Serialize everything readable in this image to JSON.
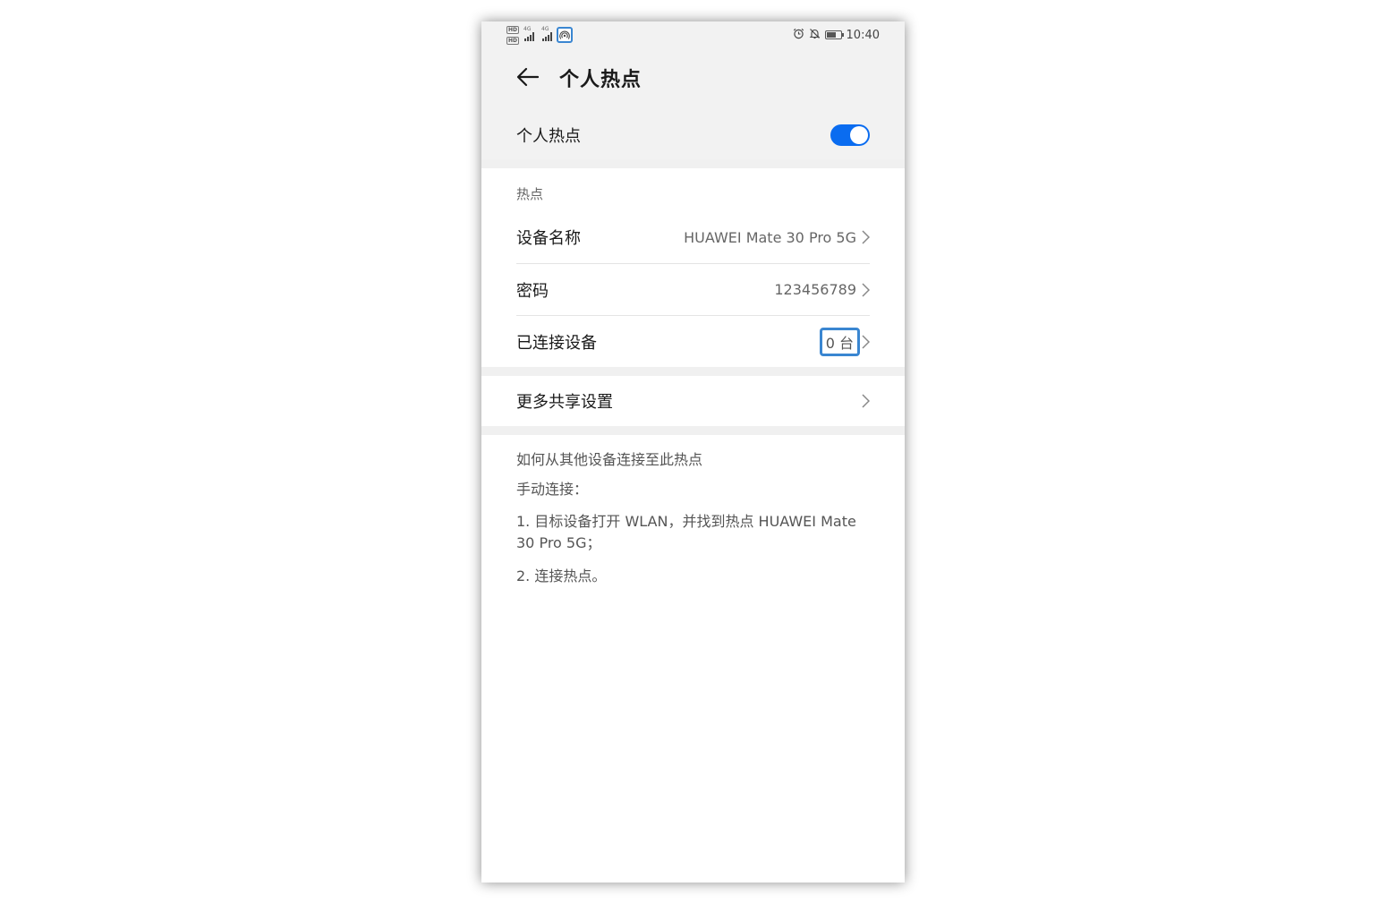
{
  "status_bar": {
    "hd_badge": "HD",
    "signal_type_1": "4G",
    "signal_type_2": "4G",
    "icons": [
      "hotspot-icon",
      "alarm-icon",
      "mute-icon",
      "battery-icon"
    ],
    "time": "10:40",
    "battery_level": 0.7
  },
  "header": {
    "back_icon": "arrow-left-icon",
    "title": "个人热点"
  },
  "hotspot_toggle": {
    "label": "个人热点",
    "enabled": true
  },
  "hotspot_section": {
    "title": "热点",
    "device_name": {
      "label": "设备名称",
      "value": "HUAWEI Mate 30 Pro 5G"
    },
    "password": {
      "label": "密码",
      "value": "123456789"
    },
    "connected_devices": {
      "label": "已连接设备",
      "value": "0 台"
    }
  },
  "more_settings": {
    "label": "更多共享设置"
  },
  "help": {
    "title": "如何从其他设备连接至此热点",
    "subtitle": "手动连接：",
    "step1": "1. 目标设备打开 WLAN，并找到热点 HUAWEI Mate 30 Pro 5G；",
    "step2": "2. 连接热点。"
  },
  "colors": {
    "accent": "#0a6cf0",
    "highlight": "#3a86d1",
    "header_bg": "#f2f2f2"
  }
}
